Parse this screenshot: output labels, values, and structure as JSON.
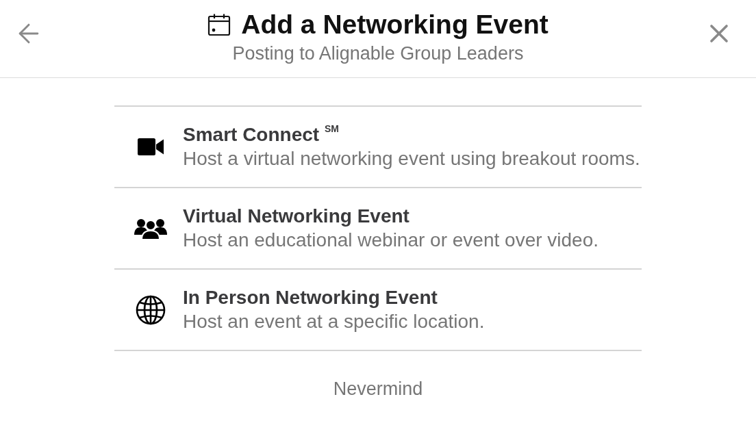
{
  "header": {
    "title": "Add a Networking Event",
    "subtitle": "Posting to Alignable Group Leaders"
  },
  "options": [
    {
      "kind": "video",
      "title": "Smart Connect $^{SM}$",
      "description": "Host a virtual networking event using breakout rooms."
    },
    {
      "kind": "group",
      "title": "Virtual Networking Event",
      "description": "Host an educational webinar or event over video."
    },
    {
      "kind": "globe",
      "title": "In Person Networking Event",
      "description": "Host an event at a specific location."
    }
  ],
  "cancel_button": "Nevermind"
}
